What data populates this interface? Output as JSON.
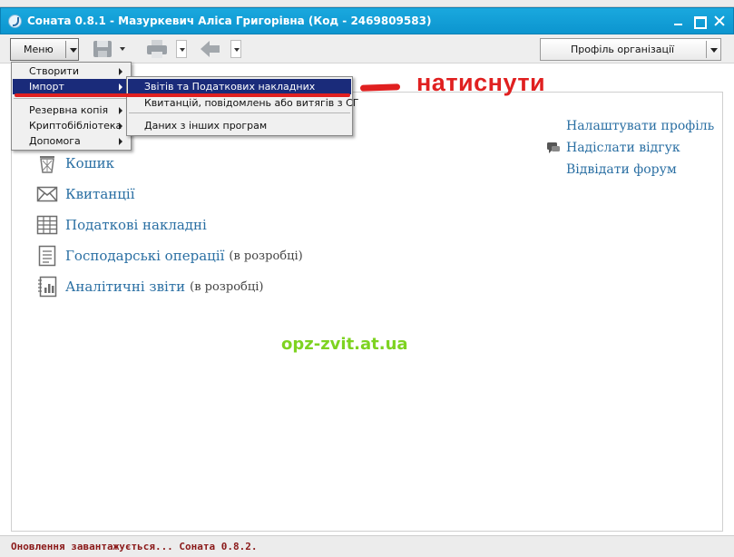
{
  "window": {
    "title": "Соната 0.8.1 - Мазуркевич Аліса Григорівна (Код - 2469809583)"
  },
  "toolbar": {
    "menu_label": "Меню",
    "profile_label": "Профіль організації"
  },
  "menu": {
    "items": [
      {
        "label": "Створити",
        "has_submenu": true
      },
      {
        "label": "Імпорт",
        "has_submenu": true,
        "selected": true
      },
      {
        "label": "Резервна копія",
        "has_submenu": true
      },
      {
        "label": "Криптобібліотека",
        "has_submenu": true
      },
      {
        "label": "Допомога",
        "has_submenu": true
      }
    ]
  },
  "submenu": {
    "items": [
      {
        "label": "Звітів та Податкових накладних",
        "selected": true
      },
      {
        "label": "Квитанцій, повідомлень або витягів з СГ"
      },
      {
        "label": "Даних з інших програм"
      }
    ]
  },
  "nav": {
    "items": [
      {
        "label": "Кошик",
        "note": "",
        "icon": "trash-icon"
      },
      {
        "label": "Квитанції",
        "note": "",
        "icon": "envelope-icon"
      },
      {
        "label": "Податкові накладні",
        "note": "",
        "icon": "grid-table-icon"
      },
      {
        "label": "Господарські операції",
        "note": "(в розробці)",
        "icon": "document-lines-icon"
      },
      {
        "label": "Аналітичні звіти",
        "note": "(в розробці)",
        "icon": "notebook-chart-icon"
      }
    ]
  },
  "side_links": {
    "configure_profile": "Налаштувати профіль",
    "send_feedback": "Надіслати відгук",
    "visit_forum": "Відвідати форум"
  },
  "annotation": {
    "text": "натиснути",
    "color": "#e02020"
  },
  "watermark": {
    "text": "opz-zvit.at.ua",
    "color": "#7ed321"
  },
  "status": {
    "text": "Оновлення завантажується... Соната 0.8.2.",
    "color": "#8b1a1a"
  },
  "colors": {
    "titlebar": "#0c95cf",
    "link": "#2a6fa3",
    "menu_selection": "#1a2b7a"
  }
}
